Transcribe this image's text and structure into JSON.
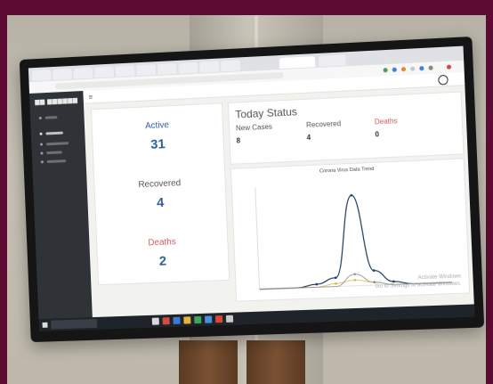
{
  "colors": {
    "accent_blue": "#2f5f93",
    "deaths_red": "#d05a5a",
    "sidebar": "#2f3237",
    "frame": "#5e0b34"
  },
  "icons": {
    "user": "user-icon",
    "menu": "hamburger-icon",
    "start": "windows-start-icon"
  },
  "summary": {
    "active_label": "Active",
    "active_value": "31",
    "recovered_label": "Recovered",
    "recovered_value": "4",
    "deaths_label": "Deaths",
    "deaths_value": "2"
  },
  "today": {
    "title": "Today Status",
    "new_cases_label": "New Cases",
    "new_cases_value": "8",
    "recovered_label": "Recovered",
    "recovered_value": "4",
    "deaths_label": "Deaths",
    "deaths_value": "0"
  },
  "chart_data": {
    "type": "line",
    "title": "Corona Virus Data Trend",
    "subtitle": "",
    "series": [
      {
        "color": "#1b3a5c",
        "values": [
          0,
          0,
          0,
          1,
          3,
          31,
          5,
          1,
          0,
          0,
          0
        ]
      },
      {
        "color": "#e1b24a",
        "values": [
          0,
          0,
          0,
          0,
          1,
          2,
          1,
          0,
          0,
          0,
          0
        ]
      },
      {
        "color": "#8c8c8c",
        "values": [
          0,
          0,
          0,
          0,
          0,
          4,
          1,
          0,
          0,
          0,
          0
        ]
      }
    ],
    "ylim": [
      0,
      35
    ],
    "grid": false
  },
  "watermark": {
    "line1": "Activate Windows",
    "line2": "Go to Settings to activate Windows."
  }
}
